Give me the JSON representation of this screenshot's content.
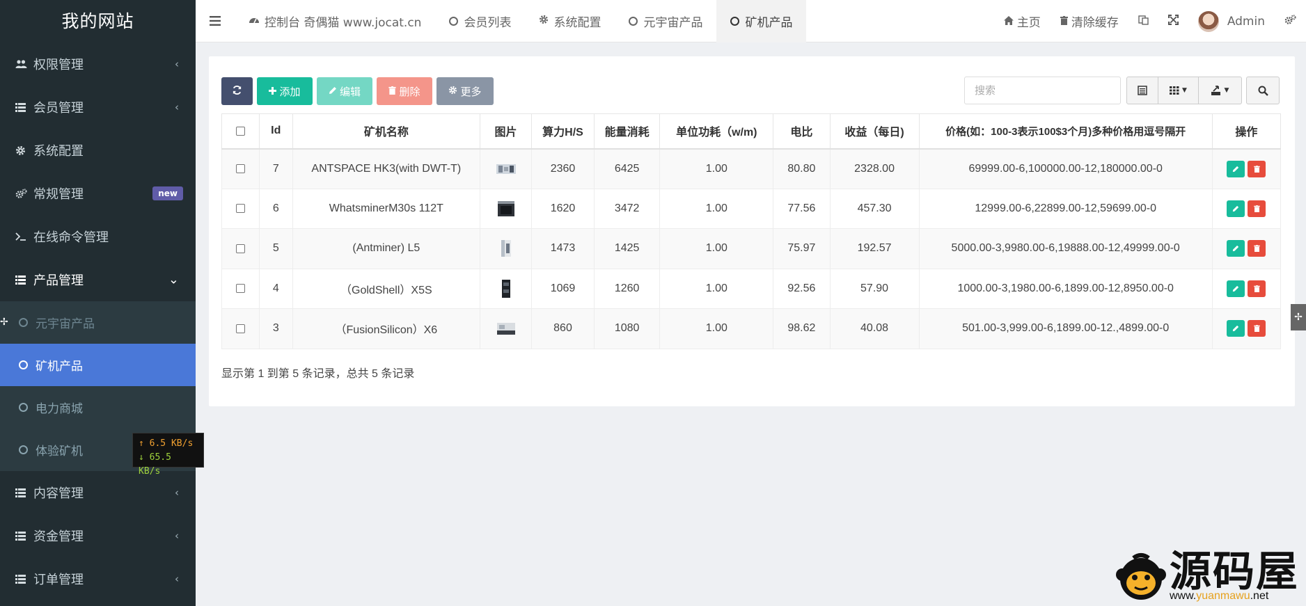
{
  "sidebar": {
    "brand": "我的网站",
    "items": [
      {
        "label": "权限管理",
        "icon": "users-icon",
        "caret": "‹"
      },
      {
        "label": "会员管理",
        "icon": "list-icon",
        "caret": "‹"
      },
      {
        "label": "系统配置",
        "icon": "gear-icon",
        "caret": ""
      },
      {
        "label": "常规管理",
        "icon": "gears-icon",
        "badge": "new"
      },
      {
        "label": "在线命令管理",
        "icon": "terminal-icon",
        "caret": ""
      },
      {
        "label": "产品管理",
        "icon": "list-icon",
        "caret": "⌄"
      }
    ],
    "subitems": [
      "元宇宙产品",
      "矿机产品",
      "电力商城",
      "体验矿机"
    ],
    "items_bottom": [
      {
        "label": "内容管理",
        "icon": "list-icon",
        "caret": "‹"
      },
      {
        "label": "资金管理",
        "icon": "list-icon",
        "caret": "‹"
      },
      {
        "label": "订单管理",
        "icon": "list-icon",
        "caret": "‹"
      }
    ]
  },
  "netspeed": {
    "up": "↑ 6.5 KB/s",
    "down": "↓ 65.5 KB/s"
  },
  "topbar": {
    "tabs": [
      {
        "label": "控制台 奇偶猫 www.jocat.cn",
        "icon": "dashboard-icon"
      },
      {
        "label": "会员列表",
        "icon": "circle-icon"
      },
      {
        "label": "系统配置",
        "icon": "gear-icon"
      },
      {
        "label": "元宇宙产品",
        "icon": "circle-icon"
      },
      {
        "label": "矿机产品",
        "icon": "circle-icon"
      }
    ],
    "home": "主页",
    "clear_cache": "清除缓存",
    "user": "Admin"
  },
  "toolbar": {
    "add": "添加",
    "edit": "编辑",
    "delete": "删除",
    "more": "更多",
    "search_placeholder": "搜索"
  },
  "table": {
    "headers": [
      "Id",
      "矿机名称",
      "图片",
      "算力H/S",
      "能量消耗",
      "单位功耗（w/m)",
      "电比",
      "收益（每日)",
      "价格(如：100-3表示100$3个月)多种价格用逗号隔开",
      "操作"
    ],
    "rows": [
      {
        "id": "7",
        "name": "ANTSPACE HK3(with DWT-T)",
        "hashrate": "2360",
        "energy": "6425",
        "unit_power": "1.00",
        "ratio": "80.80",
        "income": "2328.00",
        "price": "69999.00-6,100000.00-12,180000.00-0"
      },
      {
        "id": "6",
        "name": "WhatsminerM30s 112T",
        "hashrate": "1620",
        "energy": "3472",
        "unit_power": "1.00",
        "ratio": "77.56",
        "income": "457.30",
        "price": "12999.00-6,22899.00-12,59699.00-0"
      },
      {
        "id": "5",
        "name": "(Antminer) L5",
        "hashrate": "1473",
        "energy": "1425",
        "unit_power": "1.00",
        "ratio": "75.97",
        "income": "192.57",
        "price": "5000.00-3,9980.00-6,19888.00-12,49999.00-0"
      },
      {
        "id": "4",
        "name": "（GoldShell）X5S",
        "hashrate": "1069",
        "energy": "1260",
        "unit_power": "1.00",
        "ratio": "92.56",
        "income": "57.90",
        "price": "1000.00-3,1980.00-6,1899.00-12,8950.00-0"
      },
      {
        "id": "3",
        "name": "（FusionSilicon）X6",
        "hashrate": "860",
        "energy": "1080",
        "unit_power": "1.00",
        "ratio": "98.62",
        "income": "40.08",
        "price": "501.00-3,999.00-6,1899.00-12.,4899.00-0"
      }
    ],
    "summary": "显示第 1 到第 5 条记录，总共 5 条记录"
  },
  "watermark": {
    "big": "源码屋",
    "small_a": "www.",
    "small_accent": "yuanmawu",
    "small_b": ".net"
  }
}
